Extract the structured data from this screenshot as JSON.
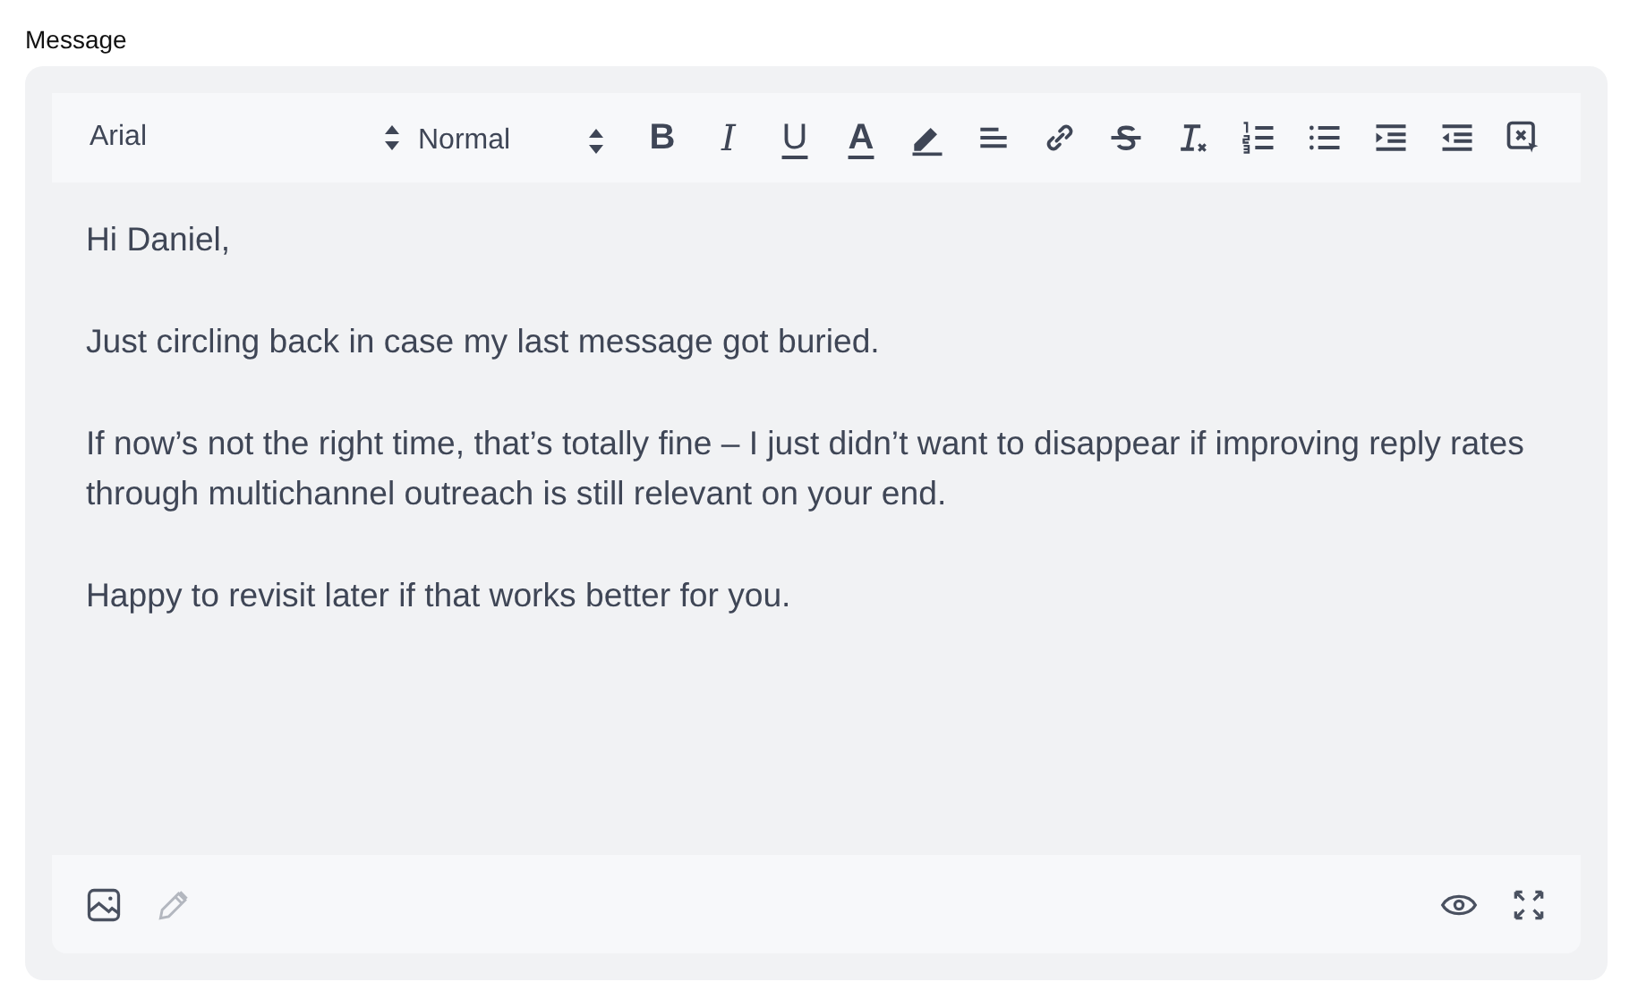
{
  "label": "Message",
  "toolbar": {
    "font": "Arial",
    "size": "Normal",
    "buttons": [
      {
        "kind": "bold",
        "glyph": "B"
      },
      {
        "kind": "italic",
        "glyph": "I"
      },
      {
        "kind": "underline",
        "glyph": "U"
      },
      {
        "kind": "color",
        "glyph": "A"
      },
      {
        "kind": "highlight"
      },
      {
        "kind": "align"
      },
      {
        "kind": "link"
      },
      {
        "kind": "strike"
      },
      {
        "kind": "clean"
      },
      {
        "kind": "ordered"
      },
      {
        "kind": "bullet"
      },
      {
        "kind": "indent"
      },
      {
        "kind": "outdent"
      },
      {
        "kind": "remove"
      }
    ]
  },
  "body": [
    "Hi Daniel,",
    "Just circling back in case my last message got buried.",
    "If now’s not the right time, that’s totally fine – I just didn’t want to disappear if improving reply rates through multichannel outreach is still relevant on your end.",
    "Happy to revisit later if that works better for you."
  ],
  "footer": {
    "left": [
      {
        "kind": "image",
        "disabled": false
      },
      {
        "kind": "pencil",
        "disabled": true
      }
    ],
    "right": [
      {
        "kind": "eye",
        "disabled": false
      },
      {
        "kind": "expand",
        "disabled": false
      }
    ]
  }
}
